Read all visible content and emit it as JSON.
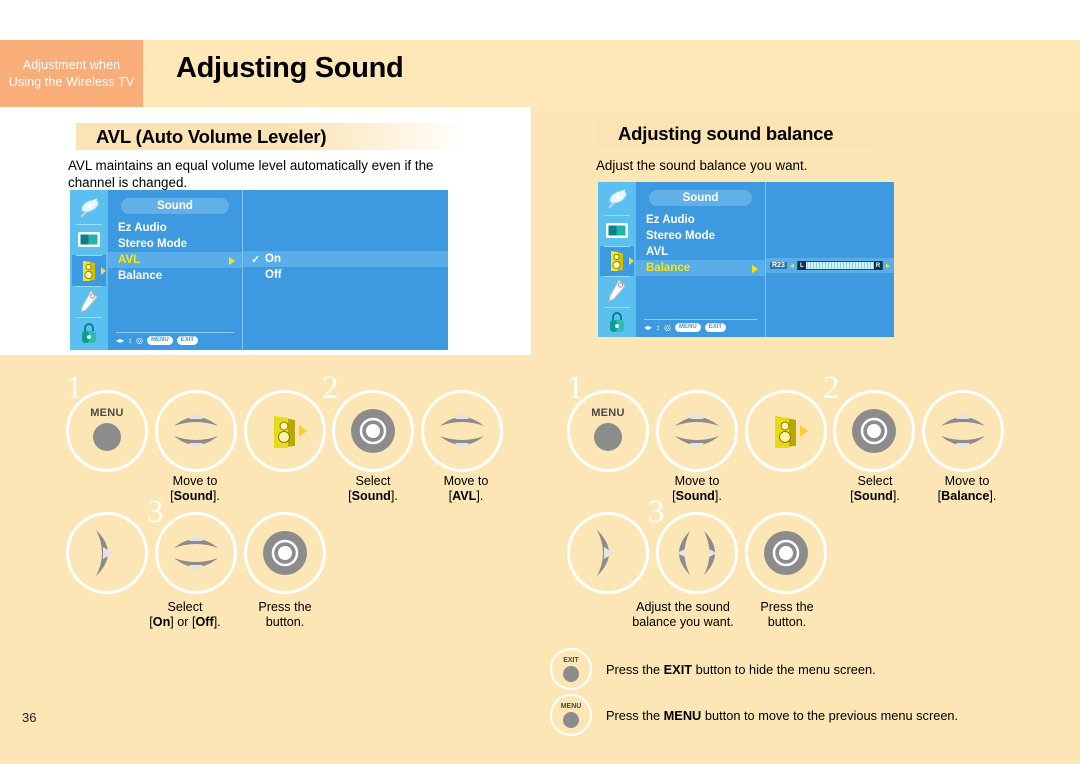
{
  "header": {
    "tab_line1": "Adjustment when",
    "tab_line2": "Using the Wireless TV",
    "title": "Adjusting Sound",
    "tab_bg": "#f9ad79",
    "band_bg": "#ffe7b8"
  },
  "page_number": "36",
  "sections": [
    {
      "heading": "AVL (Auto Volume Leveler)",
      "body": "AVL maintains an equal volume level automatically even if the channel is changed."
    },
    {
      "heading": "Adjusting sound balance",
      "body": "Adjust the sound balance you want."
    }
  ],
  "osd_left": {
    "rail_icons": [
      "satellite-dish-icon",
      "picture-screen-icon",
      "speaker-sound-icon",
      "pencil-setup-icon",
      "padlock-icon"
    ],
    "selected_rail_index": 2,
    "title": "Sound",
    "items": [
      "Ez Audio",
      "Stereo Mode",
      "AVL",
      "Balance"
    ],
    "highlighted_item": "AVL",
    "options": [
      "On",
      "Off"
    ],
    "checked_option": "On",
    "footer_glyphs": [
      "◂▸",
      "↕",
      "◎"
    ],
    "footer_pills": [
      "MENU",
      "EXIT"
    ]
  },
  "osd_right": {
    "rail_icons": [
      "satellite-dish-icon",
      "picture-screen-icon",
      "speaker-sound-icon",
      "pencil-setup-icon",
      "padlock-icon"
    ],
    "selected_rail_index": 2,
    "title": "Sound",
    "items": [
      "Ez Audio",
      "Stereo Mode",
      "AVL",
      "Balance"
    ],
    "highlighted_item": "Balance",
    "balance_value": "R23",
    "balance_left_cap": "L",
    "balance_right_cap": "R",
    "footer_glyphs": [
      "◂▸",
      "↕",
      "◎"
    ],
    "footer_pills": [
      "MENU",
      "EXIT"
    ]
  },
  "steps_left": {
    "numbers": [
      "1",
      "2",
      "3"
    ],
    "menu_button_label": "MENU",
    "captions": [
      {
        "line1": "Move to",
        "line2_pre": "[",
        "line2_bold": "Sound",
        "line2_post": "]."
      },
      {
        "line1": "Select",
        "line2_pre": "[",
        "line2_bold": "Sound",
        "line2_post": "]."
      },
      {
        "line1": "Move to",
        "line2_pre": "[",
        "line2_bold": "AVL",
        "line2_post": "]."
      },
      {
        "line1": "Select",
        "line2_pre": "[",
        "line2_bold": "On",
        "line2_mid": "] or [",
        "line2_bold2": "Off",
        "line2_post": "]."
      },
      {
        "line1": "Press the",
        "line2_plain": "button."
      }
    ]
  },
  "steps_right": {
    "numbers": [
      "1",
      "2",
      "3"
    ],
    "menu_button_label": "MENU",
    "captions": [
      {
        "line1": "Move to",
        "line2_pre": "[",
        "line2_bold": "Sound",
        "line2_post": "]."
      },
      {
        "line1": "Select",
        "line2_pre": "[",
        "line2_bold": "Sound",
        "line2_post": "]."
      },
      {
        "line1": "Move to",
        "line2_pre": "[",
        "line2_bold": "Balance",
        "line2_post": "]."
      },
      {
        "line1": "Adjust the sound",
        "line2_plain": "balance you want."
      },
      {
        "line1": "Press the",
        "line2_plain": "button."
      }
    ]
  },
  "notes": [
    {
      "button_label": "EXIT",
      "pre": "Press the ",
      "bold": "EXIT",
      "post": " button to hide the menu screen."
    },
    {
      "button_label": "MENU",
      "pre": "Press the ",
      "bold": "MENU",
      "post": " button to move to the previous menu screen."
    }
  ]
}
